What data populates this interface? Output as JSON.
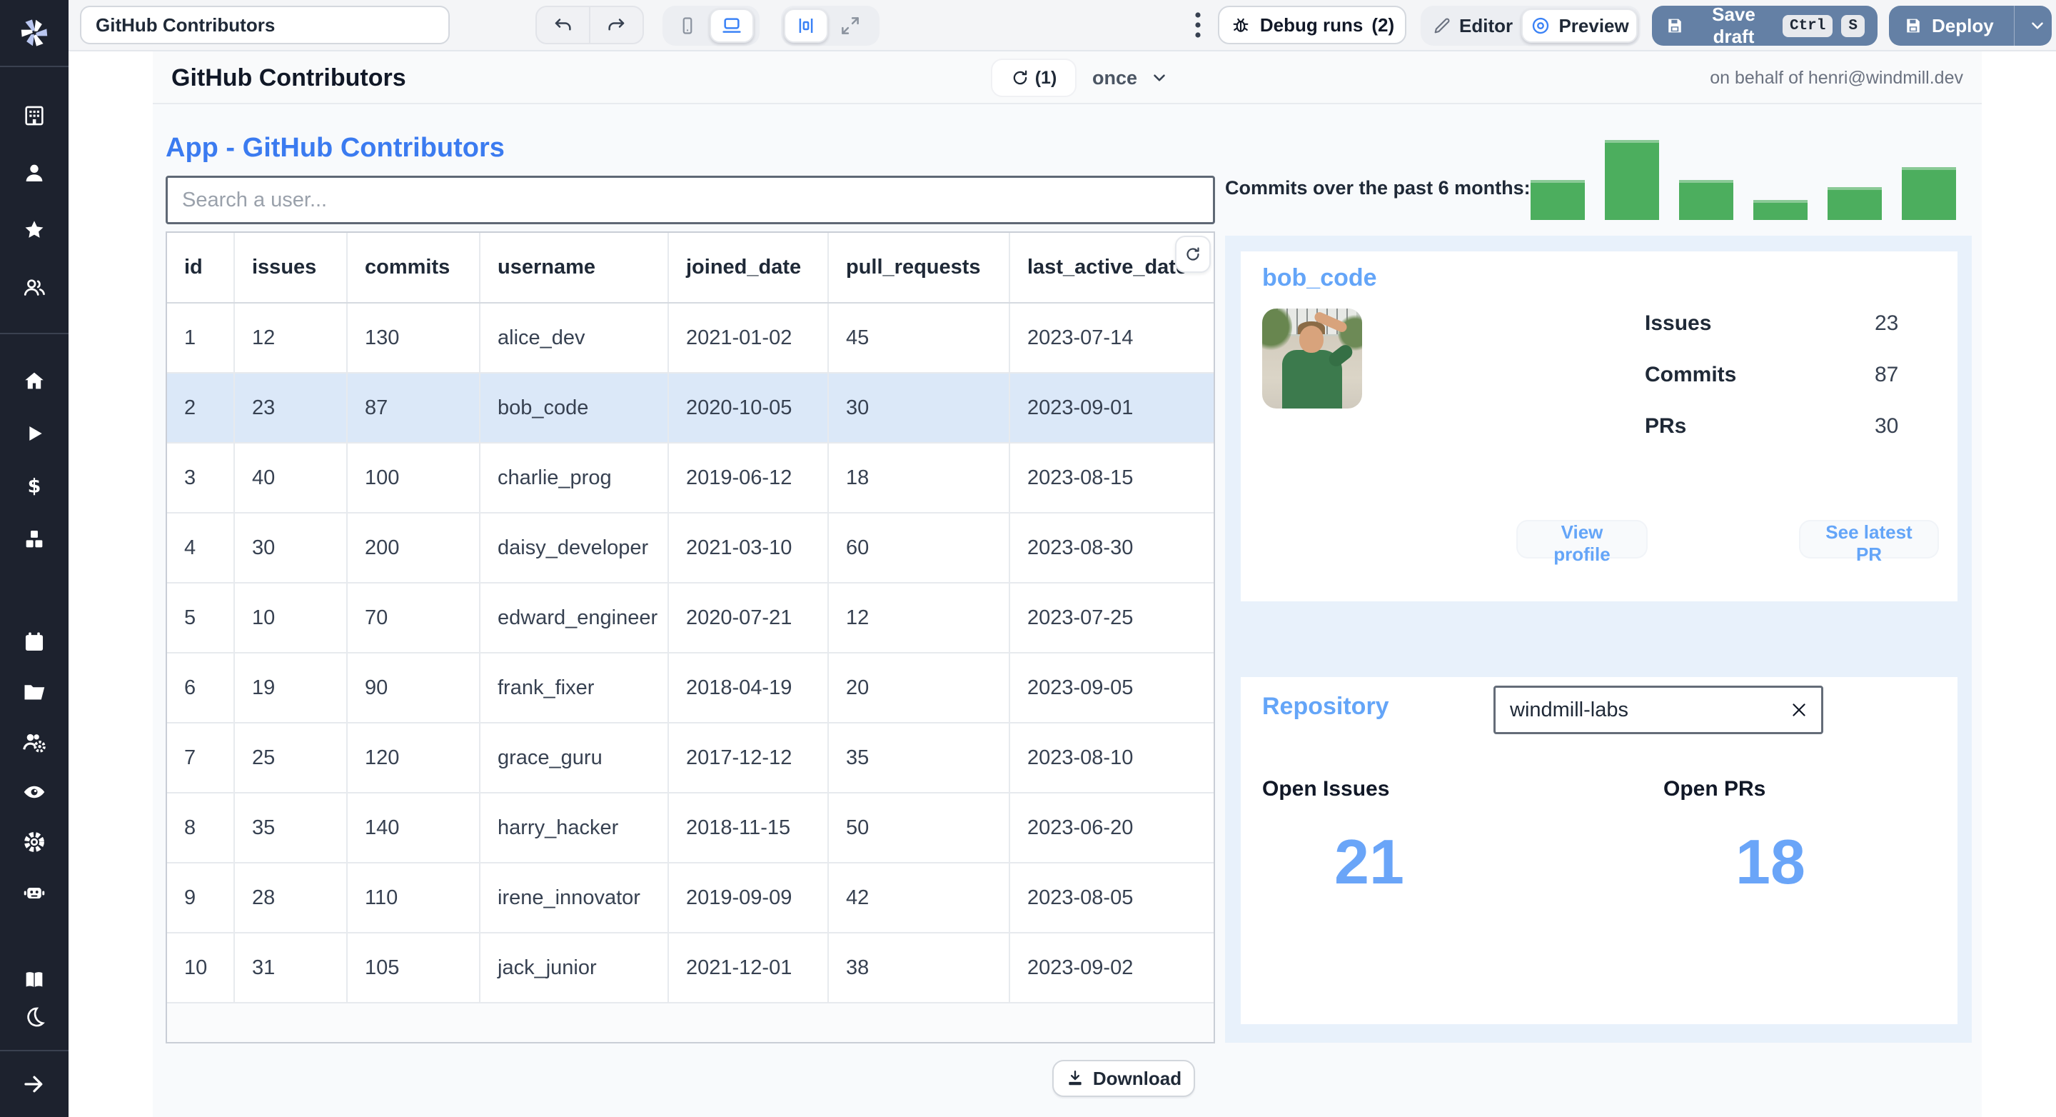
{
  "colors": {
    "accent_blue": "#3b82f6",
    "heading_blue": "#3b7bf0",
    "card_title_blue": "#64a5f8",
    "big_number_blue": "#6aa5f8",
    "save_deploy_button": "#6480a5",
    "bar_green": "#4cae5e",
    "selected_row": "#dbe8f8",
    "panel_light_blue": "#e8f1fb",
    "sidebar_dark": "#1d222e"
  },
  "sidebar": {
    "icon_names": [
      "windmill-logo",
      "building",
      "user",
      "star",
      "users",
      "home",
      "play",
      "dollar",
      "cubes",
      "calendar",
      "folder",
      "users-gear",
      "eye",
      "gear",
      "robot",
      "book",
      "moon",
      "arrow-right"
    ]
  },
  "toolbar": {
    "app_title_input": "GitHub Contributors",
    "debug_runs_label": "Debug runs",
    "debug_runs_count": "(2)",
    "editor_label": "Editor",
    "preview_label": "Preview",
    "save_draft_label": "Save draft",
    "kbd_ctrl": "Ctrl",
    "kbd_s": "S",
    "deploy_label": "Deploy"
  },
  "header": {
    "title": "GitHub Contributors",
    "refresh_count": "(1)",
    "schedule_label": "once",
    "on_behalf": "on behalf of henri@windmill.dev"
  },
  "main": {
    "app_heading": "App - GitHub Contributors",
    "search_placeholder": "Search a user...",
    "table": {
      "columns": [
        "id",
        "issues",
        "commits",
        "username",
        "joined_date",
        "pull_requests",
        "last_active_date"
      ],
      "rows": [
        [
          1,
          12,
          130,
          "alice_dev",
          "2021-01-02",
          45,
          "2023-07-14"
        ],
        [
          2,
          23,
          87,
          "bob_code",
          "2020-10-05",
          30,
          "2023-09-01"
        ],
        [
          3,
          40,
          100,
          "charlie_prog",
          "2019-06-12",
          18,
          "2023-08-15"
        ],
        [
          4,
          30,
          200,
          "daisy_developer",
          "2021-03-10",
          60,
          "2023-08-30"
        ],
        [
          5,
          10,
          70,
          "edward_engineer",
          "2020-07-21",
          12,
          "2023-07-25"
        ],
        [
          6,
          19,
          90,
          "frank_fixer",
          "2018-04-19",
          20,
          "2023-09-05"
        ],
        [
          7,
          25,
          120,
          "grace_guru",
          "2017-12-12",
          35,
          "2023-08-10"
        ],
        [
          8,
          35,
          140,
          "harry_hacker",
          "2018-11-15",
          50,
          "2023-06-20"
        ],
        [
          9,
          28,
          110,
          "irene_innovator",
          "2019-09-09",
          42,
          "2023-08-05"
        ],
        [
          10,
          31,
          105,
          "jack_junior",
          "2021-12-01",
          38,
          "2023-09-02"
        ]
      ],
      "selected_row_index": 1,
      "download_label": "Download"
    }
  },
  "right": {
    "chart_label": "Commits over the past 6 months:",
    "user_card": {
      "title": "bob_code",
      "stats": [
        {
          "label": "Issues",
          "value": "23"
        },
        {
          "label": "Commits",
          "value": "87"
        },
        {
          "label": "PRs",
          "value": "30"
        }
      ],
      "view_profile_label": "View profile",
      "see_latest_pr_label": "See latest PR"
    },
    "repo_card": {
      "title": "Repository",
      "input_value": "windmill-labs",
      "open_issues_label": "Open Issues",
      "open_issues_value": "21",
      "open_prs_label": "Open PRs",
      "open_prs_value": "18"
    }
  },
  "chart_data": {
    "type": "bar",
    "title": "Commits over the past 6 months:",
    "categories": [
      "",
      "",
      "",
      "",
      "",
      ""
    ],
    "values": [
      30,
      60,
      30,
      15,
      25,
      40
    ],
    "note": "no axis labels visible; values estimated from relative bar heights",
    "bar_color": "#4cae5e"
  }
}
